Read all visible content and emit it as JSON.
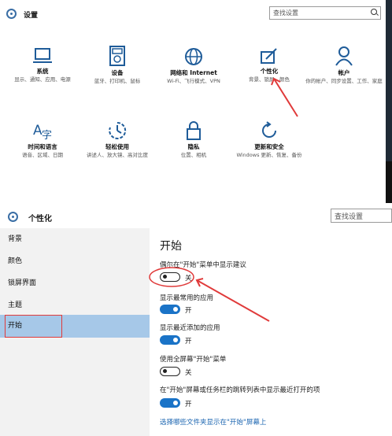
{
  "top_window": {
    "title": "设置",
    "search_placeholder": "查找设置",
    "tiles": [
      {
        "name": "系统",
        "desc": "显示、通知、应用、电源",
        "icon": "laptop-icon"
      },
      {
        "name": "设备",
        "desc": "蓝牙、打印机、鼠标",
        "icon": "keyboard-icon"
      },
      {
        "name": "网络和 Internet",
        "desc": "Wi-Fi、飞行模式、VPN",
        "icon": "globe-icon"
      },
      {
        "name": "个性化",
        "desc": "背景、锁屏、颜色",
        "icon": "paint-icon"
      },
      {
        "name": "帐户",
        "desc": "你的帐户、同步设置、工作、家庭",
        "icon": "person-icon"
      },
      {
        "name": "时间和语言",
        "desc": "语音、区域、日期",
        "icon": "time-language-icon"
      },
      {
        "name": "轻松使用",
        "desc": "讲述人、放大镜、高对比度",
        "icon": "ease-of-access-icon"
      },
      {
        "name": "隐私",
        "desc": "位置、相机",
        "icon": "lock-icon"
      },
      {
        "name": "更新和安全",
        "desc": "Windows 更新、恢复、备份",
        "icon": "refresh-icon"
      }
    ]
  },
  "bottom_window": {
    "title": "个性化",
    "search_placeholder": "查找设置",
    "sidebar": [
      {
        "label": "背景",
        "active": false
      },
      {
        "label": "颜色",
        "active": false
      },
      {
        "label": "锁屏界面",
        "active": false
      },
      {
        "label": "主题",
        "active": false
      },
      {
        "label": "开始",
        "active": true
      }
    ],
    "heading": "开始",
    "options": [
      {
        "label": "偶尔在\"开始\"菜单中显示建议",
        "state": "关",
        "on": false
      },
      {
        "label": "显示最常用的应用",
        "state": "开",
        "on": true
      },
      {
        "label": "显示最近添加的应用",
        "state": "开",
        "on": true
      },
      {
        "label": "使用全屏幕\"开始\"菜单",
        "state": "关",
        "on": false
      },
      {
        "label": "在\"开始\"屏幕或任务栏的跳转列表中显示最近打开的项",
        "state": "开",
        "on": true
      }
    ],
    "link": "选择哪些文件夹显示在\"开始\"屏幕上"
  },
  "colors": {
    "accent": "#1a73c7",
    "sidebar_active": "#a6c8e8",
    "annotation": "#e03a3a",
    "icon_blue": "#1f5c99"
  }
}
